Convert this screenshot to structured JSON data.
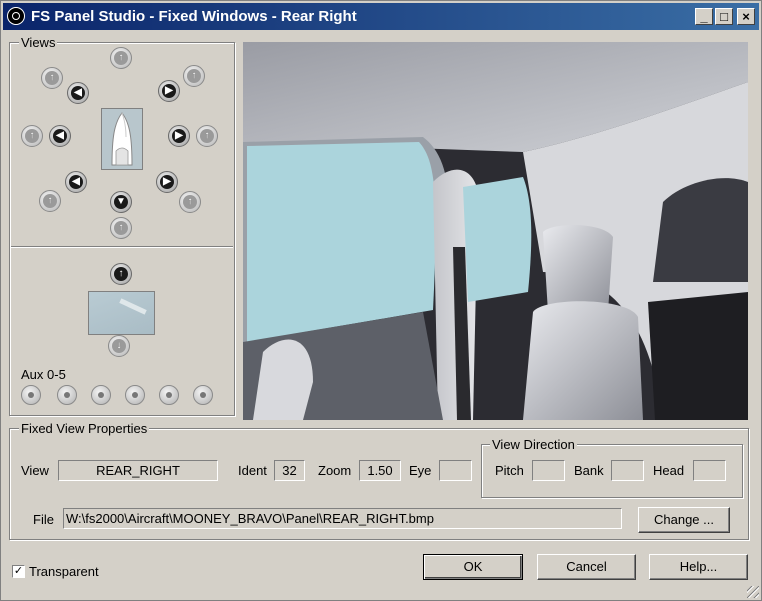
{
  "window": {
    "title": "FS Panel Studio - Fixed Windows - Rear Right",
    "buttons": {
      "minimize": "_",
      "maximize": "□",
      "close": "×"
    }
  },
  "views": {
    "group_label": "Views",
    "aux_label": "Aux 0-5",
    "aux_count": 6
  },
  "properties": {
    "group_label": "Fixed View Properties",
    "view_label": "View",
    "view_value": "REAR_RIGHT",
    "ident_label": "Ident",
    "ident_value": "32",
    "zoom_label": "Zoom",
    "zoom_value": "1.50",
    "eye_label": "Eye",
    "eye_value": "",
    "file_label": "File",
    "file_value": "W:\\fs2000\\Aircraft\\MOONEY_BRAVO\\Panel\\REAR_RIGHT.bmp",
    "change_button": "Change ..."
  },
  "direction": {
    "group_label": "View Direction",
    "pitch_label": "Pitch",
    "pitch_value": "",
    "bank_label": "Bank",
    "bank_value": "",
    "head_label": "Head",
    "head_value": ""
  },
  "footer": {
    "transparent_label": "Transparent",
    "transparent_checked": true,
    "ok": "OK",
    "cancel": "Cancel",
    "help": "Help..."
  }
}
